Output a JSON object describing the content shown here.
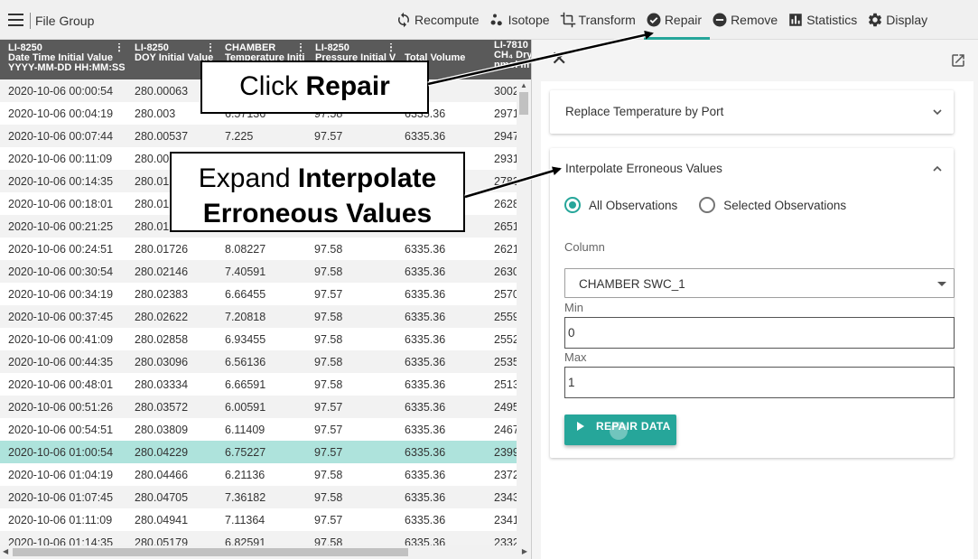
{
  "app": {
    "title": "File Group"
  },
  "colors": {
    "accent": "#26a69a",
    "header_bg": "#5a5a5a",
    "selected_row": "#aee3dc"
  },
  "menu": [
    {
      "label": "Recompute",
      "icon": "refresh-icon"
    },
    {
      "label": "Isotope",
      "icon": "isotope-icon"
    },
    {
      "label": "Transform",
      "icon": "crop-icon"
    },
    {
      "label": "Repair",
      "icon": "check-circle-icon",
      "active": true
    },
    {
      "label": "Remove",
      "icon": "remove-circle-icon"
    },
    {
      "label": "Statistics",
      "icon": "bar-chart-icon"
    },
    {
      "label": "Display",
      "icon": "gear-icon"
    }
  ],
  "table": {
    "columns": [
      {
        "lines": [
          "LI-8250",
          "Date Time Initial Value",
          "YYYY-MM-DD HH:MM:SS"
        ]
      },
      {
        "lines": [
          "LI-8250",
          "DOY Initial Value"
        ]
      },
      {
        "lines": [
          "CHAMBER",
          "Temperature Initi"
        ]
      },
      {
        "lines": [
          "LI-8250",
          "Pressure Initial V"
        ]
      },
      {
        "lines": [
          "Total Volume"
        ]
      },
      {
        "lines": [
          "LI-7810",
          "CH₄ Dry",
          "nmol m"
        ]
      }
    ],
    "rows": [
      [
        "2020-10-06 00:00:54",
        "280.00063",
        "",
        "",
        "36",
        "3002"
      ],
      [
        "2020-10-06 00:04:19",
        "280.003",
        "6.57136",
        "97.58",
        "6335.36",
        "2971"
      ],
      [
        "2020-10-06 00:07:44",
        "280.00537",
        "7.225",
        "97.57",
        "6335.36",
        "2947"
      ],
      [
        "2020-10-06 00:11:09",
        "280.00",
        "",
        "",
        "",
        "2931"
      ],
      [
        "2020-10-06 00:14:35",
        "280.01",
        "",
        "",
        "",
        "2783"
      ],
      [
        "2020-10-06 00:18:01",
        "280.01",
        "",
        "",
        "",
        "2628"
      ],
      [
        "2020-10-06 00:21:25",
        "280.01",
        "",
        "",
        "",
        "2651"
      ],
      [
        "2020-10-06 00:24:51",
        "280.01726",
        "8.08227",
        "97.58",
        "6335.36",
        "2621"
      ],
      [
        "2020-10-06 00:30:54",
        "280.02146",
        "7.40591",
        "97.58",
        "6335.36",
        "2630"
      ],
      [
        "2020-10-06 00:34:19",
        "280.02383",
        "6.66455",
        "97.57",
        "6335.36",
        "2570"
      ],
      [
        "2020-10-06 00:37:45",
        "280.02622",
        "7.20818",
        "97.58",
        "6335.36",
        "2559"
      ],
      [
        "2020-10-06 00:41:09",
        "280.02858",
        "6.93455",
        "97.58",
        "6335.36",
        "2552"
      ],
      [
        "2020-10-06 00:44:35",
        "280.03096",
        "6.56136",
        "97.58",
        "6335.36",
        "2535"
      ],
      [
        "2020-10-06 00:48:01",
        "280.03334",
        "6.66591",
        "97.58",
        "6335.36",
        "2513"
      ],
      [
        "2020-10-06 00:51:26",
        "280.03572",
        "6.00591",
        "97.57",
        "6335.36",
        "2495"
      ],
      [
        "2020-10-06 00:54:51",
        "280.03809",
        "6.11409",
        "97.57",
        "6335.36",
        "2467"
      ],
      [
        "2020-10-06 01:00:54",
        "280.04229",
        "6.75227",
        "97.57",
        "6335.36",
        "2399"
      ],
      [
        "2020-10-06 01:04:19",
        "280.04466",
        "6.21136",
        "97.58",
        "6335.36",
        "2372"
      ],
      [
        "2020-10-06 01:07:45",
        "280.04705",
        "7.36182",
        "97.58",
        "6335.36",
        "2343"
      ],
      [
        "2020-10-06 01:11:09",
        "280.04941",
        "7.11364",
        "97.57",
        "6335.36",
        "2341"
      ],
      [
        "2020-10-06 01:14:35",
        "280.05179",
        "6.82591",
        "97.58",
        "6335.36",
        "2332"
      ]
    ],
    "selected_row": 16
  },
  "panel": {
    "cards": [
      {
        "title": "Replace Temperature by Port",
        "expanded": false
      },
      {
        "title": "Interpolate Erroneous Values",
        "expanded": true
      }
    ],
    "radio_all": "All Observations",
    "radio_selected": "Selected Observations",
    "column_label": "Column",
    "column_value": "CHAMBER SWC_1",
    "min_label": "Min",
    "min_value": "0",
    "max_label": "Max",
    "max_value": "1",
    "repair_button": "REPAIR DATA"
  },
  "callouts": {
    "repair": {
      "prefix": "Click ",
      "bold": "Repair"
    },
    "interpolate": {
      "prefix": "Expand ",
      "bold1": "Interpolate",
      "bold2": "Erroneous Values"
    }
  }
}
